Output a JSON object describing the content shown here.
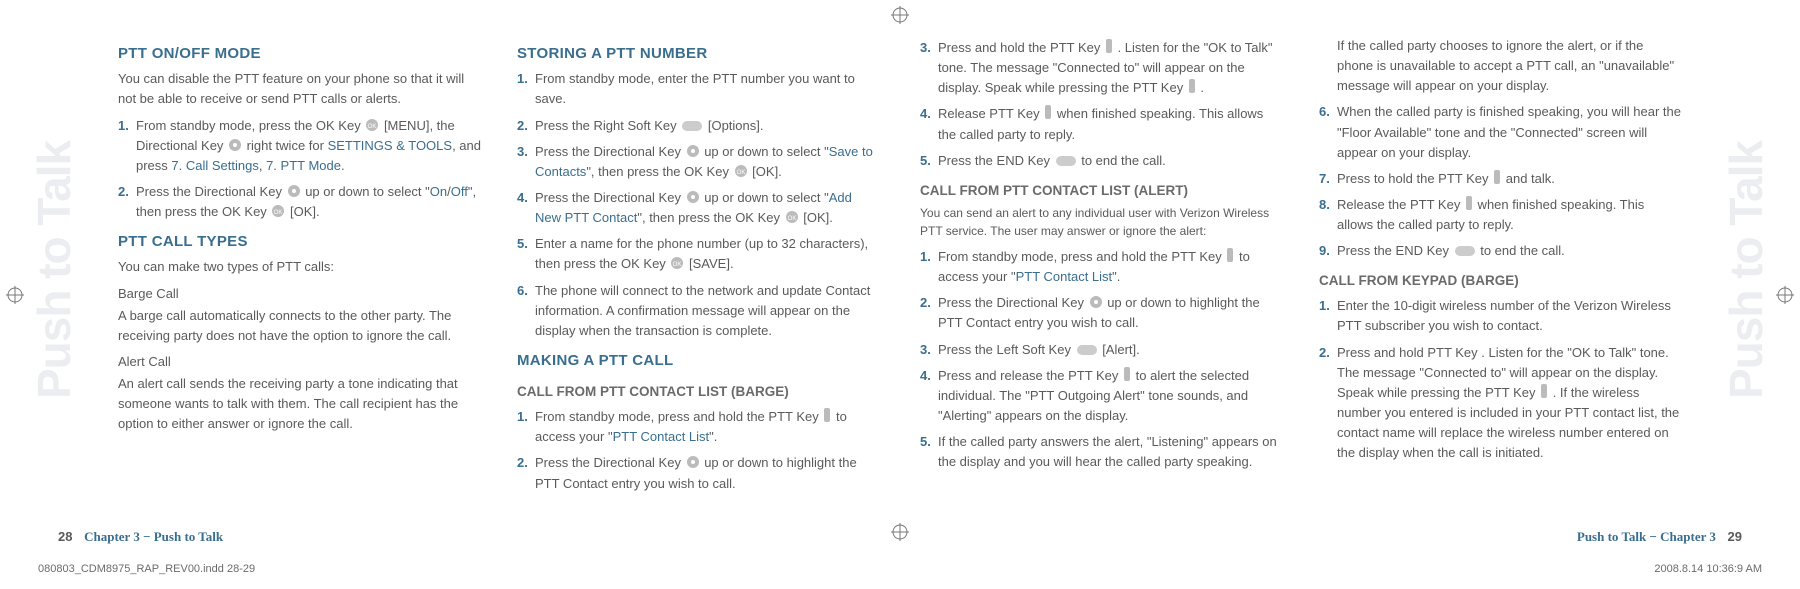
{
  "vtab_label": "Push to Talk",
  "footer": {
    "left_page_num": "28",
    "left_chapter": "Chapter 3 − Push to Talk",
    "right_chapter": "Push to Talk − Chapter 3",
    "right_page_num": "29"
  },
  "indd_line": "080803_CDM8975_RAP_REV00.indd   28-29",
  "stamp": "2008.8.14   10:36:9 AM",
  "left": {
    "col1": {
      "h_mode": "PTT ON/OFF MODE",
      "mode_body": "You can disable the PTT feature on your phone so that it will not be able to receive or send PTT calls or alerts.",
      "mode_li1_a": "From standby mode, press the OK Key ",
      "mode_li1_b": " [MENU], the Directional Key ",
      "mode_li1_c": " right twice for ",
      "mode_li1_link1": "SETTINGS & TOOLS",
      "mode_li1_d": ", and press ",
      "mode_li1_link2": "7. Call Settings",
      "mode_li1_e": ", ",
      "mode_li1_link3": "7. PTT Mode",
      "mode_li1_f": ".",
      "mode_li2_a": "Press the Directional Key ",
      "mode_li2_b": " up or down to select \"",
      "mode_li2_link1": "On",
      "mode_li2_c": "/",
      "mode_li2_link2": "Off",
      "mode_li2_d": "\", then press the OK Key ",
      "mode_li2_e": " [OK].",
      "h_types": "PTT CALL TYPES",
      "types_body": "You can make two types of PTT calls:",
      "barge_label": "Barge Call",
      "barge_body": "A barge call automatically connects to the other party. The receiving party does not have the option to ignore the call.",
      "alert_label": "Alert Call",
      "alert_body": "An alert call sends the receiving party a tone indicating that someone wants to talk with them. The call recipient has the option to either answer or ignore the call."
    },
    "col2": {
      "h_store": "STORING A PTT NUMBER",
      "s_li1": "From standby mode, enter the PTT number you want to save.",
      "s_li2_a": "Press the Right Soft Key ",
      "s_li2_b": " [Options].",
      "s_li3_a": "Press the Directional Key ",
      "s_li3_b": " up or down to select \"",
      "s_li3_link": "Save to Contacts",
      "s_li3_c": "\", then press the OK Key ",
      "s_li3_d": " [OK].",
      "s_li4_a": "Press the Directional Key ",
      "s_li4_b": " up or down to select \"",
      "s_li4_link": "Add New PTT Contact",
      "s_li4_c": "\", then press the OK Key ",
      "s_li4_d": " [OK].",
      "s_li5_a": "Enter a name for the phone number (up to 32 characters), then press the OK Key ",
      "s_li5_b": " [SAVE].",
      "s_li6": "The phone will connect to the network and update Contact information. A confirmation message will appear on the display when the transaction is complete.",
      "h_make": "MAKING A PTT CALL",
      "h_barge": "CALL FROM PTT CONTACT LIST (BARGE)",
      "b_li1_a": "From standby mode, press and hold the PTT Key ",
      "b_li1_b": " to access your \"",
      "b_li1_link": "PTT Contact List",
      "b_li1_c": "\".",
      "b_li2_a": "Press the Directional Key ",
      "b_li2_b": " up or down to highlight the PTT Contact entry you wish to call."
    }
  },
  "right": {
    "col1": {
      "b_li3_a": "Press and hold the PTT Key ",
      "b_li3_b": " . Listen for the \"OK to Talk\" tone. The message \"Connected to\" will appear on the display. Speak while pressing the PTT Key ",
      "b_li3_c": " .",
      "b_li4_a": "Release PTT Key ",
      "b_li4_b": " when finished speaking. This allows the called party to reply.",
      "b_li5_a": "Press the END Key ",
      "b_li5_b": " to end the call.",
      "h_alert": "CALL FROM PTT CONTACT LIST (ALERT)",
      "alert_intro": "You can send an alert to any individual user with Verizon Wireless PTT service. The user may answer or ignore the alert:",
      "a_li1_a": "From standby mode, press and hold the PTT Key ",
      "a_li1_b": " to access your \"",
      "a_li1_link": "PTT Contact List",
      "a_li1_c": "\".",
      "a_li2_a": "Press the Directional Key ",
      "a_li2_b": " up or down to highlight the PTT Contact entry you wish to call.",
      "a_li3_a": "Press the Left Soft Key ",
      "a_li3_b": " [Alert].",
      "a_li4_a": "Press and release the PTT Key ",
      "a_li4_b": " to alert the selected individual. The \"PTT Outgoing Alert\" tone sounds, and \"Alerting\" appears on the display.",
      "a_li5": "If the called party answers the alert, \"Listening\" appears on the display and you will hear the called party speaking."
    },
    "col2": {
      "a_cont": "If the called party chooses to ignore the alert, or if the phone is unavailable to accept a PTT call, an \"unavailable\" message will appear on your display.",
      "a_li6": "When the called party is finished speaking, you will hear the \"Floor Available\" tone and the \"Connected\" screen will appear on your display.",
      "a_li7_a": "Press to hold the PTT Key ",
      "a_li7_b": " and talk.",
      "a_li8_a": "Release the PTT Key ",
      "a_li8_b": " when finished speaking. This allows the called party to reply.",
      "a_li9_a": "Press the END Key ",
      "a_li9_b": " to end the call.",
      "h_keypad": "CALL FROM KEYPAD (BARGE)",
      "k_li1": "Enter the 10-digit wireless number of the Verizon Wireless PTT subscriber you wish to contact.",
      "k_li2_a": "Press and hold PTT Key . Listen for the \"OK to Talk\" tone. The message \"Connected to\" will appear on the display. Speak while pressing the PTT Key ",
      "k_li2_b": " . If the wireless number you entered is included in your PTT contact list, the contact name will replace the wireless number entered on the display when the call is initiated."
    }
  },
  "nums": {
    "n1": "1.",
    "n2": "2.",
    "n3": "3.",
    "n4": "4.",
    "n5": "5.",
    "n6": "6.",
    "n7": "7.",
    "n8": "8.",
    "n9": "9."
  }
}
